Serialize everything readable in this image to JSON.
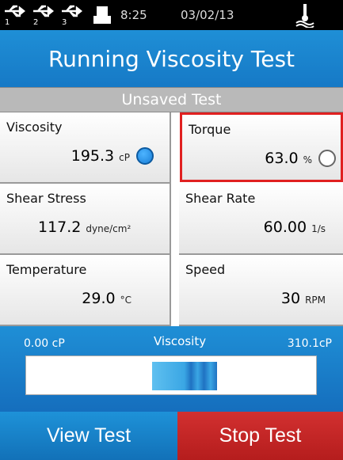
{
  "status": {
    "usb_ports": [
      "1",
      "2",
      "3"
    ],
    "time": "8:25",
    "date": "03/02/13",
    "icons": [
      "usb-icon",
      "printer-icon",
      "temperature-probe-icon"
    ]
  },
  "header": {
    "title": "Running Viscosity Test"
  },
  "subheader": {
    "status": "Unsaved Test"
  },
  "readings": {
    "viscosity": {
      "label": "Viscosity",
      "value": "195.3",
      "unit": "cP",
      "indicator": "filled"
    },
    "torque": {
      "label": "Torque",
      "value": "63.0",
      "unit": "%",
      "indicator": "empty",
      "highlighted": true
    },
    "shear_stress": {
      "label": "Shear Stress",
      "value": "117.2",
      "unit": "dyne/cm²"
    },
    "shear_rate": {
      "label": "Shear Rate",
      "value": "60.00",
      "unit": "1/s"
    },
    "temperature": {
      "label": "Temperature",
      "value": "29.0",
      "unit": "°C"
    },
    "speed": {
      "label": "Speed",
      "value": "30",
      "unit": "RPM"
    }
  },
  "viscosity_bar": {
    "title": "Viscosity",
    "min_label": "0.00 cP",
    "max_label": "310.1cP"
  },
  "buttons": {
    "view": "View Test",
    "stop": "Stop Test"
  },
  "colors": {
    "accent_blue": "#1a84cf",
    "stop_red": "#c42626",
    "highlight_red": "#e02020"
  }
}
